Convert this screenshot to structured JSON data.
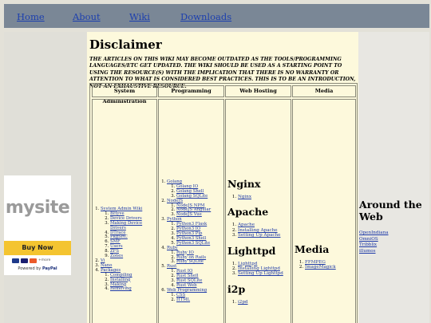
{
  "nav": {
    "home": "Home",
    "about": "About",
    "wiki": "Wiki",
    "downloads": "Downloads"
  },
  "ad": {
    "logo": "mysite",
    "buy_label": "Buy Now",
    "payment_icons": [
      "paypal-icon",
      "visa-icon",
      "mastercard-icon"
    ],
    "payment_more": "+more",
    "powered_prefix": "Powered by",
    "powered_brand": "PayPal"
  },
  "main": {
    "title": "Disclaimer",
    "note": "THE ARTICLES ON THIS WIKI MAY BECOME OUTDATED AS THE TOOLS/PROGRAMMING LANGUAGES/ETC GET UPDATED. THE WIKI SHOULD BE USED AS A STARTING POINT TO USING THE RESOURCE(S) WITH THE IMPLICATION THAT THERE IS NO WARRANTY OR ATTENTION TO WHAT IS CONSIDERED BEST PRACTICES. THIS IS TO BE AN INTRODUCTION, NOT AN EXHAUSTIVE RESOURCE.",
    "headers": [
      "System Administration",
      "Programming",
      "Web Hosting",
      "Media"
    ]
  },
  "sysadmin": {
    "system_admin_wiki": "System Admin Wiki",
    "sa_items": [
      "BHyve",
      "Device Drivers",
      "Making Device Drivers",
      "DTrace",
      "PkgSRC",
      "SMF",
      "Users",
      "ZFS",
      "Zones"
    ],
    "vi": "Vi",
    "nano": "Nano",
    "packages": "Packages",
    "pkg_items": [
      "Compiling",
      "Installing",
      "Making",
      "Removing"
    ]
  },
  "programming": {
    "golang": "Golang",
    "golang_items": [
      "Golang IO",
      "Golang Shell",
      "Golang SQLite"
    ],
    "nodejs": "NodeJS",
    "nodejs_items": [
      "NodeJS NPM",
      "NodeJS Angular",
      "NodeJS Vue"
    ],
    "python": "Python",
    "python_items": [
      "Python3 Flask",
      "Python3 IO",
      "Python3 Pip",
      "Python3 Shell",
      "Python3 SQLite"
    ],
    "ruby": "Ruby",
    "ruby_items": [
      "Ruby IO",
      "Ruby on Rails",
      "Ruby SQLite"
    ],
    "rust": "Rust",
    "rust_items": [
      "Rust IO",
      "Rust Shell",
      "Rust SQLite",
      "Rust Web"
    ],
    "web_programming": "Web Programming",
    "web_items": [
      "CSS",
      "HTML"
    ]
  },
  "webhosting": {
    "nginx_heading": "Nginx",
    "nginx_items": [
      "Nginx"
    ],
    "apache_heading": "Apache",
    "apache_items": [
      "Apache",
      "Installing Apache",
      "Setting Up Apache"
    ],
    "lighttpd_heading": "Lighttpd",
    "lighttpd_items": [
      "Lighttpd",
      "Installing Lighttpd",
      "Setting Up Lighttpd"
    ],
    "i2p_heading": "i2p",
    "i2p_items": [
      "i2pd"
    ]
  },
  "media": {
    "heading": "Media",
    "items": [
      "FFMPEG",
      "ImageMagick"
    ]
  },
  "right": {
    "heading": "Around the Web",
    "links": [
      "OpenIndiana",
      "OmniOS",
      "Tribblix",
      "illumos"
    ]
  },
  "colors": {
    "nav_bar": "#7a8796",
    "main_bg": "#fdf9dc",
    "link": "#1e3aa8",
    "buy_button": "#f4c430"
  }
}
